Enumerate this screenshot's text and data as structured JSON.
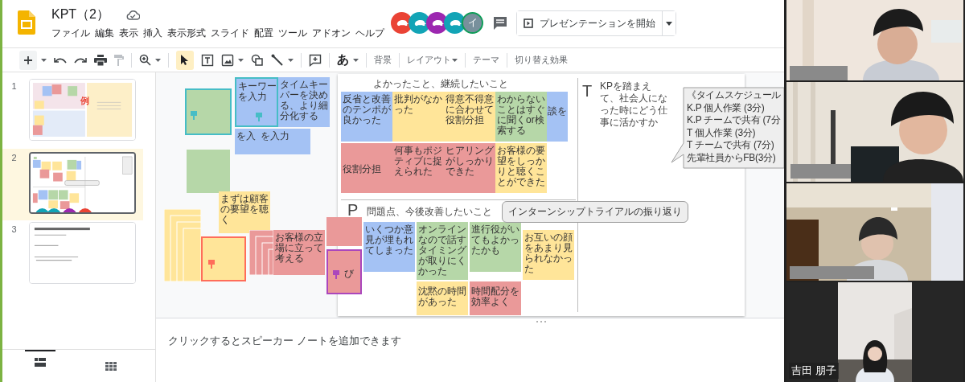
{
  "header": {
    "title": "KPT（2）",
    "menu": [
      "ファイル",
      "編集",
      "表示",
      "挿入",
      "表示形式",
      "スライド",
      "配置",
      "ツール",
      "アドオン",
      "ヘルプ"
    ],
    "collaborators": [
      {
        "kind": "animal",
        "color": "#ea4335"
      },
      {
        "kind": "animal",
        "color": "#12a4b6"
      },
      {
        "kind": "animal",
        "color": "#9c27b0"
      },
      {
        "kind": "animal",
        "color": "#12a4b6"
      },
      {
        "kind": "initial",
        "label": "イ",
        "color": "#78909c"
      }
    ],
    "present_button": "プレゼンテーションを開始"
  },
  "toolbar": {
    "select_tool": {
      "selected": true
    },
    "input_tool_label": "あ",
    "buttons": [
      {
        "label": "背景",
        "dropdown": false
      },
      {
        "label": "レイアウト",
        "dropdown": true
      },
      {
        "label": "テーマ",
        "dropdown": false
      },
      {
        "label": "切り替え効果",
        "dropdown": false
      }
    ]
  },
  "filmstrip": {
    "slides": [
      {
        "number": "1",
        "selected": false,
        "mark": "例"
      },
      {
        "number": "2",
        "selected": true
      },
      {
        "number": "3",
        "selected": false
      }
    ]
  },
  "canvas": {
    "slide": {
      "k_heading": "よかったこと、継続したいこと",
      "t_letter": "T",
      "t_text": "KPを踏まえて、社会人になった時にどう仕事に活かすか",
      "p_letter": "P",
      "p_heading": "問題点、今後改善したいこと"
    },
    "notes": [
      {
        "kind": "note",
        "color": "#b6d7a8",
        "cursor": {
          "color": "#46bdc6"
        }
      },
      {
        "kind": "note",
        "color": "#b6d7a8"
      },
      {
        "kind": "note",
        "color": "#a4c2f4",
        "cursor": {
          "color": "#46bdc6"
        },
        "text": "キーワーを入力"
      },
      {
        "kind": "note",
        "color": "#a4c2f4",
        "text": "タイムキーパーを決める、より細分化する"
      },
      {
        "kind": "note",
        "color": "#a4c2f4",
        "text": "を入"
      },
      {
        "kind": "note",
        "color": "#a4c2f4",
        "text": "を入力"
      },
      {
        "kind": "note",
        "color": "#a4c2f4",
        "text": "反省と改善のテンポが良かった"
      },
      {
        "kind": "note",
        "color": "#ffe599",
        "text": "批判がなかった"
      },
      {
        "kind": "note",
        "color": "#ffe599",
        "text": "得意不得意に合わせて役割分担"
      },
      {
        "kind": "note",
        "color": "#b6d7a8",
        "text": "わからないことはすぐに聞くor検索する"
      },
      {
        "kind": "note",
        "color": "#a4c2f4",
        "text": "談を"
      },
      {
        "kind": "note",
        "color": "#ea9999",
        "text": "役割分担"
      },
      {
        "kind": "note",
        "color": "#ea9999",
        "text": "何事もポジティブに捉えられた"
      },
      {
        "kind": "note",
        "color": "#ea9999",
        "text": "ヒアリングがしっかりできた"
      },
      {
        "kind": "note",
        "color": "#ffe599",
        "text": "お客様の要望をしっかりと聴くことができた"
      },
      {
        "kind": "note",
        "color": "#a4c2f4",
        "text": "いくつか意見が埋もれてしまった"
      },
      {
        "kind": "note",
        "color": "#b6d7a8",
        "text": "オンラインなので話すタイミングが取りにくかった"
      },
      {
        "kind": "note",
        "color": "#b6d7a8",
        "text": "進行役がいてもよかったかも"
      },
      {
        "kind": "note",
        "color": "#ffe599",
        "text": "お互いの顔をあまり見られなかった"
      },
      {
        "kind": "note",
        "color": "#ffe599",
        "text": "沈黙の時間があった"
      },
      {
        "kind": "note",
        "color": "#ea9999",
        "text": "時間配分を効率よく"
      },
      {
        "kind": "stack",
        "color": "#ffe599"
      },
      {
        "kind": "note",
        "color": "#ffe599",
        "text": "まずは顧客の要望を聴く"
      },
      {
        "kind": "note",
        "color": "#ffe599",
        "cursor": {
          "color": "#ff6d5a"
        }
      },
      {
        "kind": "stack",
        "color": "#ea9999"
      },
      {
        "kind": "note",
        "color": "#ea9999",
        "text": "お客様の立場に立って考える"
      },
      {
        "kind": "note",
        "color": "#ea9999"
      },
      {
        "kind": "note",
        "color": "#ea9999",
        "cursor": {
          "color": "#ab47bc"
        },
        "text": "び"
      }
    ],
    "callout": "インターンシップトライアルの振り返り",
    "schedule": [
      "《タイムスケジュール",
      "K.P 個人作業 (3分)",
      "K.P チームで共有 (7分",
      "T 個人作業 (3分)",
      "T チームで共有 (7分)",
      "先輩社員からFB(3分)"
    ]
  },
  "speaker_notes": {
    "placeholder": "クリックするとスピーカー ノートを追加できます"
  },
  "video_tiles": [
    {
      "kind": "picture"
    },
    {
      "kind": "picture"
    },
    {
      "kind": "picture"
    },
    {
      "kind": "picture",
      "name": "吉田 朋子"
    }
  ]
}
